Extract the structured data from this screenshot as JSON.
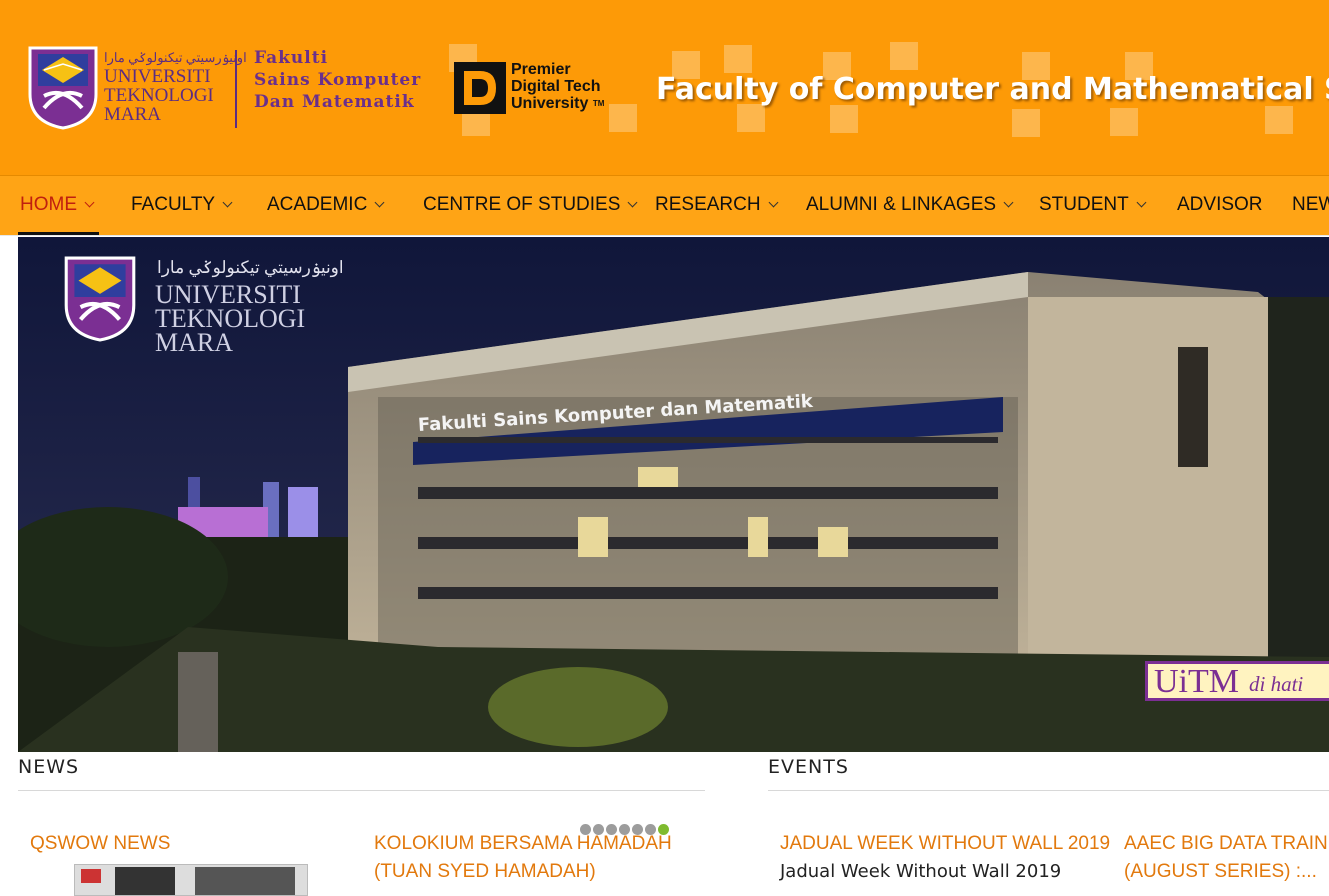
{
  "header": {
    "uitm_arabic": "اونيۏرسيتي تيكنولوݢي مارا",
    "uitm_lines": [
      "UNIVERSITI",
      "TEKNOLOGI",
      "MARA"
    ],
    "fakulti_lines": [
      "Fakulti",
      "Sains Komputer",
      "Dan Matematik"
    ],
    "premier_lines": [
      "Premier",
      "Digital Tech",
      "University"
    ],
    "premier_tm": "TM",
    "banner_title": "Faculty of Computer and Mathematical Sciences"
  },
  "nav": {
    "items": [
      {
        "label": "HOME",
        "dropdown": true,
        "active": true
      },
      {
        "label": "FACULTY",
        "dropdown": true
      },
      {
        "label": "ACADEMIC",
        "dropdown": true
      },
      {
        "label": "CENTRE OF STUDIES",
        "dropdown": true
      },
      {
        "label": "RESEARCH",
        "dropdown": true
      },
      {
        "label": "ALUMNI & LINKAGES",
        "dropdown": true
      },
      {
        "label": "STUDENT",
        "dropdown": true
      },
      {
        "label": "ADVISOR",
        "dropdown": false
      },
      {
        "label": "NEWS",
        "dropdown": false
      }
    ]
  },
  "hero": {
    "uni_arabic": "اونيۏرسيتي تيكنولوݢي مارا",
    "uni_lines": [
      "UNIVERSITI",
      "TEKNOLOGI",
      "MARA"
    ],
    "building_sign": "Fakulti Sains Komputer dan Matematik",
    "badge_main": "UiTM",
    "badge_sub": "di hati"
  },
  "news": {
    "heading": "NEWS",
    "slider_dots": 7,
    "active_dot": 6,
    "cards": [
      {
        "title": "QSWOW NEWS"
      },
      {
        "title_lines": [
          "KOLOKIUM BERSAMA HAMADAH",
          "(TUAN SYED HAMADAH)"
        ]
      }
    ]
  },
  "events": {
    "heading": "EVENTS",
    "cards": [
      {
        "title": "JADUAL WEEK WITHOUT WALL 2019",
        "body": "Jadual Week Without Wall 2019"
      },
      {
        "title_lines": [
          "AAEC BIG DATA TRAINING",
          "(AUGUST SERIES) :..."
        ]
      }
    ]
  },
  "colors": {
    "header_bg": "#fd9a07",
    "nav_bg": "#ffa415",
    "active_nav": "#c0200f",
    "card_title": "#e2790d",
    "uitm_purple": "#5b2c83",
    "dot_active": "#7fbb2f"
  }
}
